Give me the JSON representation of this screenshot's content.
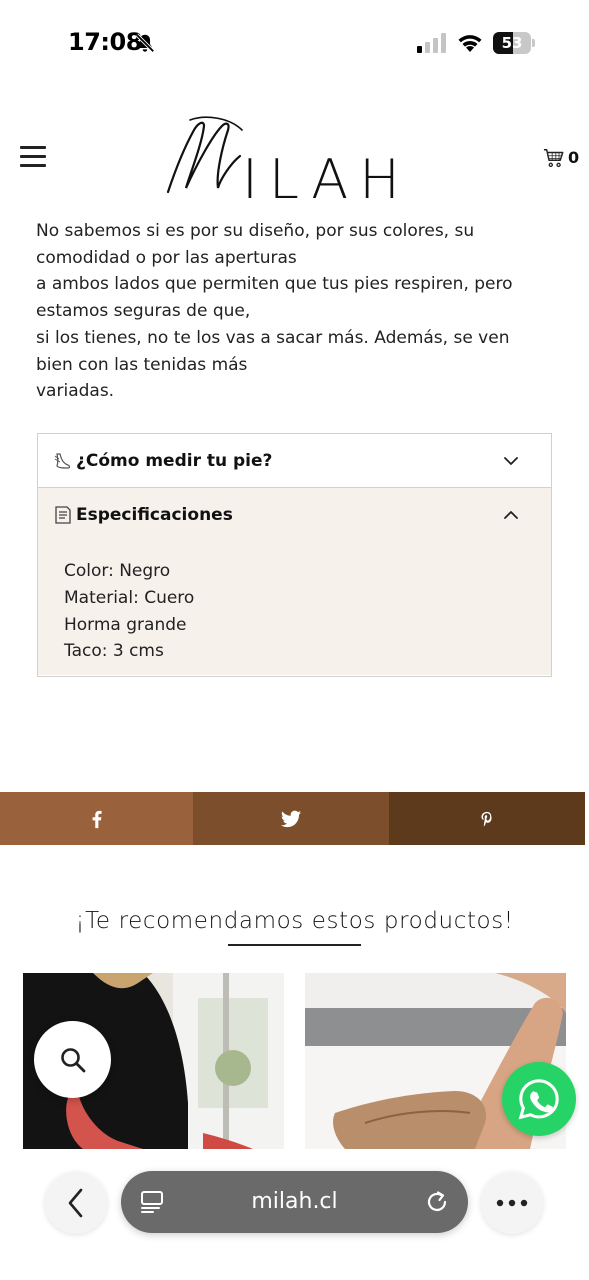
{
  "status_bar": {
    "time": "17:08",
    "battery": "53",
    "battery_level_percent": 53,
    "icons": [
      "bell-slash-icon",
      "signal-icon",
      "wifi-icon",
      "battery-icon"
    ]
  },
  "header": {
    "logo_text": "ILAH",
    "cart_count": "0",
    "icons": [
      "hamburger-menu-icon",
      "cart-icon"
    ]
  },
  "description": {
    "lines": [
      "No sabemos si es por su diseño, por sus colores, su",
      "comodidad o por las aperturas",
      "a ambos lados que permiten que tus pies respiren, pero",
      "estamos seguras de que,",
      "si los tienes, no te los vas a sacar más. Además, se ven",
      "bien con las tenidas más",
      "variadas."
    ]
  },
  "accordion": {
    "items": [
      {
        "title": "¿Cómo medir tu pie?",
        "icon": "foot-icon",
        "expanded": false
      },
      {
        "title": "Especificaciones",
        "icon": "document-icon",
        "expanded": true
      }
    ],
    "specs": [
      "Color: Negro",
      "Material: Cuero",
      "Horma grande",
      "Taco: 3 cms"
    ]
  },
  "share": {
    "buttons": [
      {
        "network": "facebook",
        "icon": "facebook-icon",
        "color": "#9a623c"
      },
      {
        "network": "twitter",
        "icon": "twitter-icon",
        "color": "#7c4e2c"
      },
      {
        "network": "pinterest",
        "icon": "pinterest-icon",
        "color": "#5e3a1d"
      }
    ]
  },
  "recommendations": {
    "title": "¡Te recomendamos estos productos!"
  },
  "browser": {
    "url": "milah.cl",
    "icons": [
      "back-arrow-icon",
      "tabs-icon",
      "reload-icon",
      "more-dots-icon"
    ]
  },
  "colors": {
    "accordion_open_bg": "#f7f1ec",
    "whatsapp": "#25d366",
    "url_pill": "#6a6a6a"
  }
}
